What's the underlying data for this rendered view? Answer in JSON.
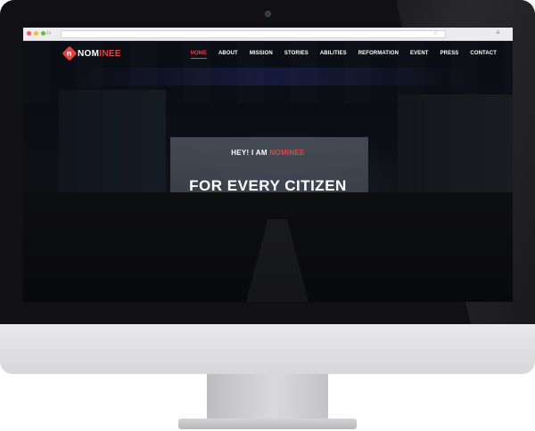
{
  "logo": {
    "mark": "n",
    "text_white": "NOM",
    "text_red": "INEE"
  },
  "nav": {
    "items": [
      {
        "label": "HOME",
        "active": true
      },
      {
        "label": "ABOUT"
      },
      {
        "label": "MISSION"
      },
      {
        "label": "STORIES"
      },
      {
        "label": "ABILITIES"
      },
      {
        "label": "REFORMATION"
      },
      {
        "label": "EVENT"
      },
      {
        "label": "PRESS"
      },
      {
        "label": "CONTACT"
      }
    ]
  },
  "hero": {
    "subtitle_prefix": "HEY! I AM ",
    "subtitle_accent": "NOMINEE",
    "title": "FOR EVERY CITIZEN"
  },
  "colors": {
    "accent": "#e8403e",
    "bezel": "#111114",
    "chin": "#e2e2e4"
  },
  "icons": [
    "camera-icon",
    "window-close-icon",
    "window-minimize-icon",
    "window-maximize-icon",
    "back-icon",
    "forward-icon",
    "bookmark-star-icon",
    "browser-menu-icon",
    "logo-mark-icon"
  ]
}
